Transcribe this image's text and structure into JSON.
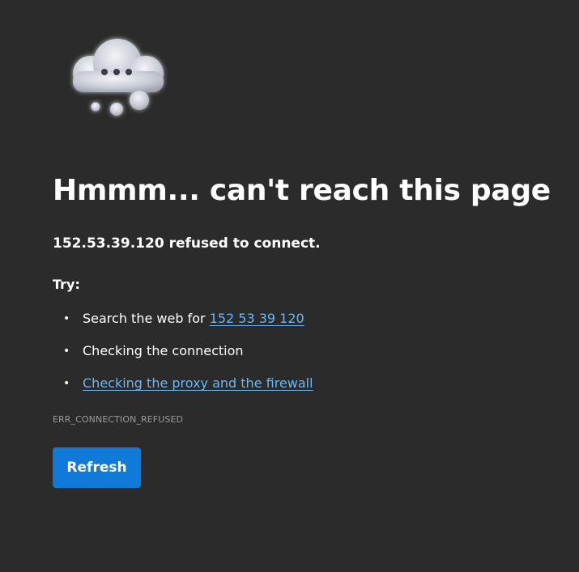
{
  "page": {
    "icon": "thinking-cloud-icon",
    "headline": "Hmmm... can't reach this page",
    "message": {
      "host": "152.53.39.120",
      "text": " refused to connect."
    },
    "try_label": "Try:",
    "suggestions": [
      {
        "text": "Search the web for ",
        "link": "152 53 39 120"
      },
      {
        "text": "Checking the connection"
      },
      {
        "link": "Checking the proxy and the firewall"
      }
    ],
    "error_code": "ERR_CONNECTION_REFUSED",
    "refresh_label": "Refresh"
  },
  "colors": {
    "background": "#2b2b2b",
    "text": "#ffffff",
    "link": "#6bb5f5",
    "error_code": "#9a9a9a",
    "button": "#0f7ad8"
  }
}
